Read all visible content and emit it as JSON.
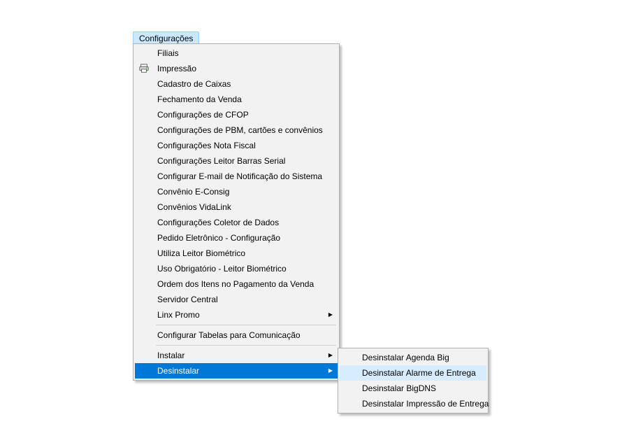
{
  "menubar": {
    "configuracoes_label": "Configurações"
  },
  "main_menu": {
    "sections": [
      {
        "items": [
          {
            "label": "Filiais",
            "has_submenu": false,
            "icon": null,
            "selected": false
          },
          {
            "label": "Impressão",
            "has_submenu": false,
            "icon": "printer",
            "selected": false
          },
          {
            "label": "Cadastro de Caixas",
            "has_submenu": false,
            "icon": null,
            "selected": false
          },
          {
            "label": "Fechamento da Venda",
            "has_submenu": false,
            "icon": null,
            "selected": false
          },
          {
            "label": "Configurações de CFOP",
            "has_submenu": false,
            "icon": null,
            "selected": false
          },
          {
            "label": "Configurações de PBM, cartões e convênios",
            "has_submenu": false,
            "icon": null,
            "selected": false
          },
          {
            "label": "Configurações Nota Fiscal",
            "has_submenu": false,
            "icon": null,
            "selected": false
          },
          {
            "label": "Configurações Leitor Barras Serial",
            "has_submenu": false,
            "icon": null,
            "selected": false
          },
          {
            "label": "Configurar E-mail de Notificação do Sistema",
            "has_submenu": false,
            "icon": null,
            "selected": false
          },
          {
            "label": "Convênio E-Consig",
            "has_submenu": false,
            "icon": null,
            "selected": false
          },
          {
            "label": "Convênios VidaLink",
            "has_submenu": false,
            "icon": null,
            "selected": false
          },
          {
            "label": "Configurações Coletor de Dados",
            "has_submenu": false,
            "icon": null,
            "selected": false
          },
          {
            "label": "Pedido Eletrônico - Configuração",
            "has_submenu": false,
            "icon": null,
            "selected": false
          },
          {
            "label": "Utiliza Leitor Biométrico",
            "has_submenu": false,
            "icon": null,
            "selected": false
          },
          {
            "label": "Uso Obrigatório - Leitor Biométrico",
            "has_submenu": false,
            "icon": null,
            "selected": false
          },
          {
            "label": "Ordem dos Itens no Pagamento da Venda",
            "has_submenu": false,
            "icon": null,
            "selected": false
          },
          {
            "label": "Servidor Central",
            "has_submenu": false,
            "icon": null,
            "selected": false
          },
          {
            "label": "Linx Promo",
            "has_submenu": true,
            "icon": null,
            "selected": false
          }
        ]
      },
      {
        "items": [
          {
            "label": "Configurar Tabelas para Comunicação",
            "has_submenu": false,
            "icon": null,
            "selected": false
          }
        ]
      },
      {
        "items": [
          {
            "label": "Instalar",
            "has_submenu": true,
            "icon": null,
            "selected": false
          },
          {
            "label": "Desinstalar",
            "has_submenu": true,
            "icon": null,
            "selected": true
          }
        ]
      }
    ]
  },
  "sub_menu": {
    "items": [
      {
        "label": "Desinstalar Agenda Big",
        "hover": false
      },
      {
        "label": "Desinstalar Alarme de Entrega",
        "hover": true
      },
      {
        "label": "Desinstalar BigDNS",
        "hover": false
      },
      {
        "label": "Desinstalar Impressão de Entrega",
        "hover": false
      }
    ]
  }
}
